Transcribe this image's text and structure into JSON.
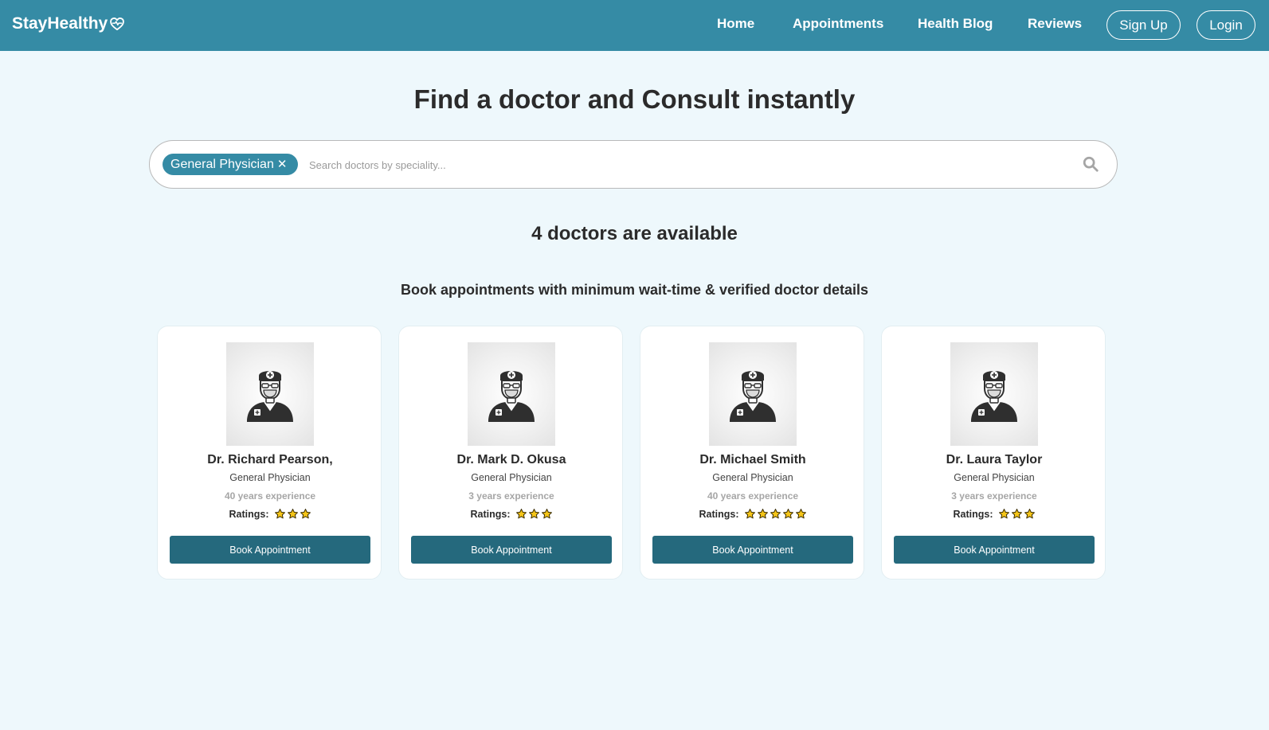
{
  "brand": {
    "name": "StayHealthy",
    "icon": "heart-pulse-icon"
  },
  "nav": {
    "links": [
      "Home",
      "Appointments",
      "Health Blog",
      "Reviews"
    ],
    "signup_label": "Sign Up",
    "login_label": "Login"
  },
  "hero": {
    "title": "Find a doctor and Consult instantly"
  },
  "search": {
    "chip_label": "General Physician",
    "chip_close": "✕",
    "placeholder": "Search doctors by speciality...",
    "value": ""
  },
  "results": {
    "count_text": "4 doctors are available",
    "subheading": "Book appointments with minimum wait-time & verified doctor details"
  },
  "doctors": [
    {
      "name": "Dr. Richard Pearson,",
      "speciality": "General Physician",
      "experience": "40 years experience",
      "ratings_label": "Ratings:",
      "stars": 3,
      "button": "Book Appointment"
    },
    {
      "name": "Dr. Mark D. Okusa",
      "speciality": "General Physician",
      "experience": "3 years experience",
      "ratings_label": "Ratings:",
      "stars": 3,
      "button": "Book Appointment"
    },
    {
      "name": "Dr. Michael Smith",
      "speciality": "General Physician",
      "experience": "40 years experience",
      "ratings_label": "Ratings:",
      "stars": 5,
      "button": "Book Appointment"
    },
    {
      "name": "Dr. Laura Taylor",
      "speciality": "General Physician",
      "experience": "3 years experience",
      "ratings_label": "Ratings:",
      "stars": 3,
      "button": "Book Appointment"
    }
  ],
  "colors": {
    "navbar": "#358ba5",
    "page_bg": "#eef8fc",
    "button": "#25697d",
    "star_fill": "#f5c518"
  }
}
